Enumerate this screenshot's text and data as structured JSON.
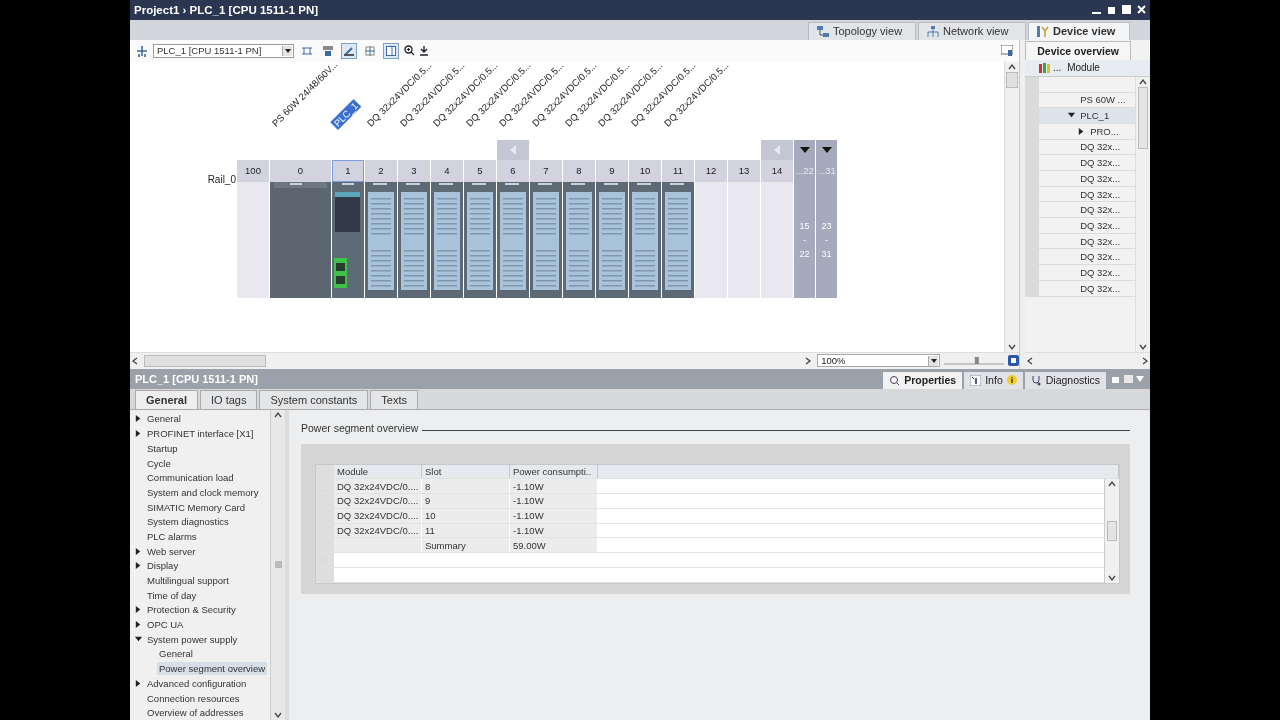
{
  "window": {
    "project": "Project1",
    "separator": "›",
    "device": "PLC_1 [CPU 1511-1 PN]"
  },
  "view_tabs": [
    {
      "label": "Topology view",
      "kind": "topology",
      "selected": false
    },
    {
      "label": "Network view",
      "kind": "network",
      "selected": false
    },
    {
      "label": "Device view",
      "kind": "device",
      "selected": true
    }
  ],
  "toolbar": {
    "device_select": "PLC_1 [CPU 1511-1 PN]"
  },
  "rack": {
    "rail": "Rail_0",
    "slots": [
      {
        "number": "100",
        "kind": "empty"
      },
      {
        "number": "0",
        "kind": "ps",
        "module": "PS 60W 24/48/60V...",
        "selected": false
      },
      {
        "number": "1",
        "kind": "cpu",
        "module": "PLC_1",
        "selected": true
      },
      {
        "number": "2",
        "kind": "dq",
        "module": "DQ 32x24VDC/0.5...",
        "selected": false
      },
      {
        "number": "3",
        "kind": "dq",
        "module": "DQ 32x24VDC/0.5...",
        "selected": false
      },
      {
        "number": "4",
        "kind": "dq",
        "module": "DQ 32x24VDC/0.5...",
        "selected": false
      },
      {
        "number": "5",
        "kind": "dq",
        "module": "DQ 32x24VDC/0.5...",
        "selected": false
      },
      {
        "number": "6",
        "kind": "dq",
        "module": "DQ 32x24VDC/0.5...",
        "selected": false,
        "collapse": true
      },
      {
        "number": "7",
        "kind": "dq",
        "module": "DQ 32x24VDC/0.5...",
        "selected": false
      },
      {
        "number": "8",
        "kind": "dq",
        "module": "DQ 32x24VDC/0.5...",
        "selected": false
      },
      {
        "number": "9",
        "kind": "dq",
        "module": "DQ 32x24VDC/0.5...",
        "selected": false
      },
      {
        "number": "10",
        "kind": "dq",
        "module": "DQ 32x24VDC/0.5...",
        "selected": false
      },
      {
        "number": "11",
        "kind": "dq",
        "module": "DQ 32x24VDC/0.5...",
        "selected": false
      },
      {
        "number": "12",
        "kind": "empty"
      },
      {
        "number": "13",
        "kind": "empty"
      },
      {
        "number": "14",
        "kind": "empty",
        "collapse": true
      },
      {
        "number": "...22",
        "kind": "range",
        "from": "15",
        "dash": "-",
        "to": "22"
      },
      {
        "number": "...31",
        "kind": "range",
        "from": "23",
        "dash": "-",
        "to": "31"
      }
    ]
  },
  "zoom": "100%",
  "zoom_slider": {
    "level": 0.55
  },
  "device_overview": {
    "tab": "Device overview",
    "more": "...",
    "column": "Module",
    "rows": [
      {
        "label": "PS 60W ...",
        "selected": false
      },
      {
        "label": "PLC_1",
        "selected": true,
        "expanded": true,
        "children": [
          {
            "label": "PRO...",
            "selected": false,
            "expanded": false
          }
        ]
      },
      {
        "label": "DQ 32x...",
        "selected": false
      },
      {
        "label": "DQ 32x...",
        "selected": false
      },
      {
        "label": "DQ 32x...",
        "selected": false
      },
      {
        "label": "DQ 32x...",
        "selected": false
      },
      {
        "label": "DQ 32x...",
        "selected": false
      },
      {
        "label": "DQ 32x...",
        "selected": false
      },
      {
        "label": "DQ 32x...",
        "selected": false
      },
      {
        "label": "DQ 32x...",
        "selected": false
      },
      {
        "label": "DQ 32x...",
        "selected": false
      },
      {
        "label": "DQ 32x...",
        "selected": false
      }
    ]
  },
  "inspector": {
    "title": "PLC_1 [CPU 1511-1 PN]",
    "panel_tabs": [
      {
        "label": "Properties",
        "kind": "properties",
        "selected": true
      },
      {
        "label": "Info",
        "kind": "info",
        "selected": false
      },
      {
        "label": "Diagnostics",
        "kind": "diagnostics",
        "selected": false
      }
    ],
    "tabs": [
      {
        "label": "General",
        "selected": true
      },
      {
        "label": "IO tags",
        "selected": false
      },
      {
        "label": "System constants",
        "selected": false
      },
      {
        "label": "Texts",
        "selected": false
      }
    ],
    "nav": [
      {
        "label": "General",
        "expanded": false,
        "selected": false
      },
      {
        "label": "PROFINET interface [X1]",
        "expanded": false,
        "selected": false
      },
      {
        "label": "Startup",
        "selected": false
      },
      {
        "label": "Cycle",
        "selected": false
      },
      {
        "label": "Communication load",
        "selected": false
      },
      {
        "label": "System and clock memory",
        "selected": false
      },
      {
        "label": "SIMATIC Memory Card",
        "selected": false
      },
      {
        "label": "System diagnostics",
        "selected": false
      },
      {
        "label": "PLC alarms",
        "selected": false
      },
      {
        "label": "Web server",
        "expanded": false,
        "selected": false
      },
      {
        "label": "Display",
        "expanded": false,
        "selected": false
      },
      {
        "label": "Multilingual support",
        "selected": false
      },
      {
        "label": "Time of day",
        "selected": false
      },
      {
        "label": "Protection & Security",
        "expanded": false,
        "selected": false
      },
      {
        "label": "OPC UA",
        "expanded": false,
        "selected": false
      },
      {
        "label": "System power supply",
        "expanded": true,
        "selected": false,
        "children": [
          {
            "label": "General",
            "selected": false
          },
          {
            "label": "Power segment overview",
            "selected": true
          }
        ]
      },
      {
        "label": "Advanced configuration",
        "expanded": false,
        "selected": false
      },
      {
        "label": "Connection resources",
        "selected": false
      },
      {
        "label": "Overview of addresses",
        "selected": false
      }
    ],
    "section": "Power segment overview",
    "table": {
      "columns": [
        "Module",
        "Slot",
        "Power consumpti.."
      ],
      "rows": [
        [
          "DQ 32x24VDC/0....",
          "8",
          "-1.10W"
        ],
        [
          "DQ 32x24VDC/0....",
          "9",
          "-1.10W"
        ],
        [
          "DQ 32x24VDC/0....",
          "10",
          "-1.10W"
        ],
        [
          "DQ 32x24VDC/0....",
          "11",
          "-1.10W"
        ],
        [
          "",
          "Summary",
          "59.00W"
        ]
      ]
    }
  }
}
